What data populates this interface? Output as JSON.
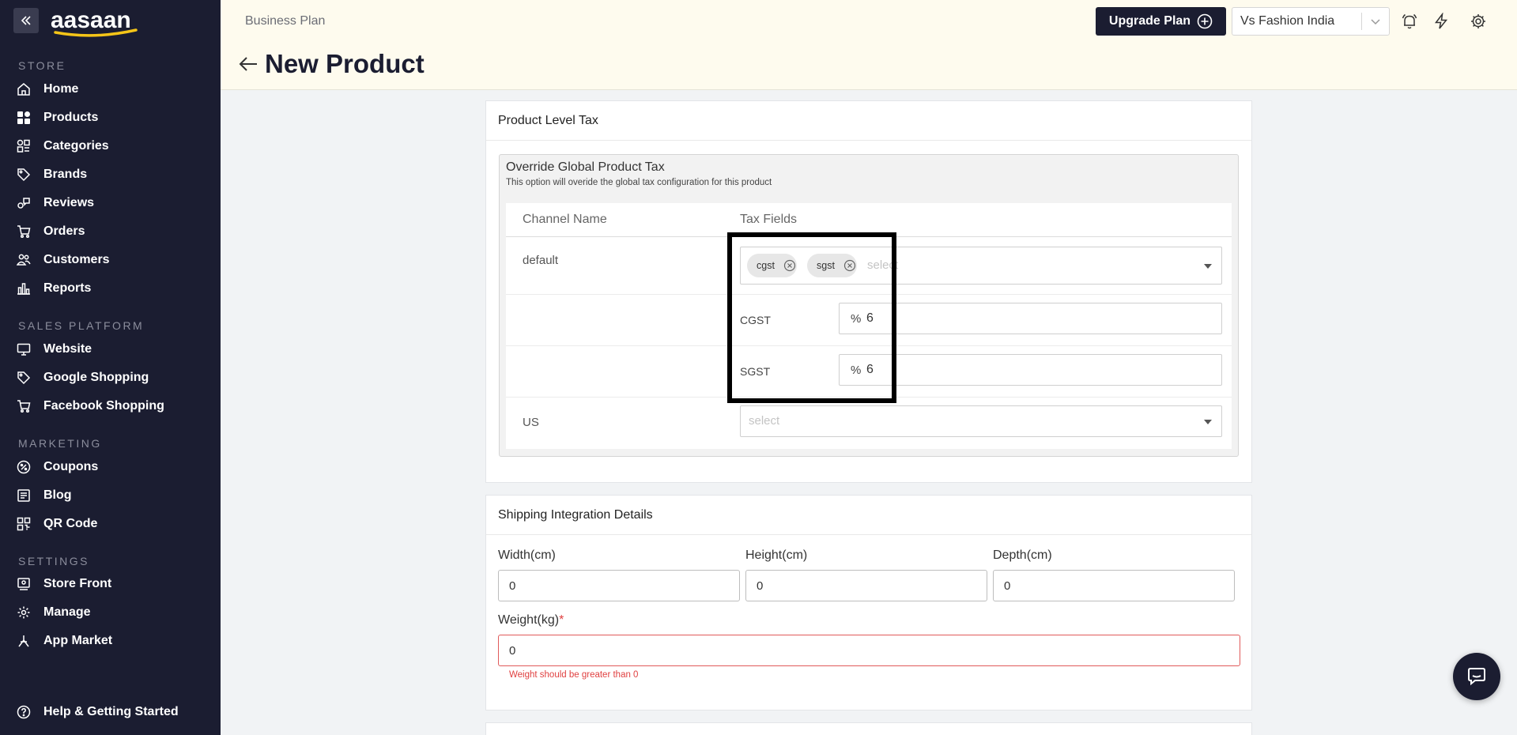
{
  "sidebar": {
    "logo_text": "aasaan",
    "sections": {
      "store": "STORE",
      "sales_platform": "SALES PLATFORM",
      "marketing": "MARKETING",
      "settings": "SETTINGS"
    },
    "store_items": [
      {
        "label": "Home",
        "icon": "home-icon"
      },
      {
        "label": "Products",
        "icon": "products-icon"
      },
      {
        "label": "Categories",
        "icon": "categories-icon"
      },
      {
        "label": "Brands",
        "icon": "tag-icon"
      },
      {
        "label": "Reviews",
        "icon": "reviews-icon"
      },
      {
        "label": "Orders",
        "icon": "cart-icon"
      },
      {
        "label": "Customers",
        "icon": "customers-icon"
      },
      {
        "label": "Reports",
        "icon": "reports-icon"
      }
    ],
    "sales_items": [
      {
        "label": "Website",
        "icon": "monitor-icon"
      },
      {
        "label": "Google Shopping",
        "icon": "tag-icon"
      },
      {
        "label": "Facebook Shopping",
        "icon": "cart-icon"
      }
    ],
    "marketing_items": [
      {
        "label": "Coupons",
        "icon": "coupon-icon"
      },
      {
        "label": "Blog",
        "icon": "blog-icon"
      },
      {
        "label": "QR Code",
        "icon": "qr-code-icon"
      }
    ],
    "settings_items": [
      {
        "label": "Store Front",
        "icon": "storefront-icon"
      },
      {
        "label": "Manage",
        "icon": "gear-icon"
      },
      {
        "label": "App Market",
        "icon": "app-market-icon"
      }
    ],
    "help": {
      "label": "Help & Getting Started",
      "icon": "help-icon"
    }
  },
  "header": {
    "plan": "Business Plan",
    "title": "New Product",
    "upgrade_label": "Upgrade Plan",
    "store_name": "Vs Fashion India"
  },
  "product_tax": {
    "card_title": "Product Level Tax",
    "override_title": "Override Global Product Tax",
    "override_desc": "This option will overide the global tax configuration for this product",
    "columns": [
      "Channel Name",
      "Tax Fields"
    ],
    "default_channel": "default",
    "chips": [
      "cgst",
      "sgst"
    ],
    "select_placeholder": "select",
    "cgst_label": "CGST",
    "cgst_unit": "%",
    "cgst_value": "6",
    "sgst_label": "SGST",
    "sgst_unit": "%",
    "sgst_value": "6",
    "us_channel": "US",
    "us_placeholder": "select"
  },
  "shipping": {
    "card_title": "Shipping Integration Details",
    "width_label": "Width(cm)",
    "width_value": "0",
    "height_label": "Height(cm)",
    "height_value": "0",
    "depth_label": "Depth(cm)",
    "depth_value": "0",
    "weight_label": "Weight(kg)",
    "weight_required": "*",
    "weight_value": "0",
    "weight_error": "Weight should be greater than 0"
  }
}
